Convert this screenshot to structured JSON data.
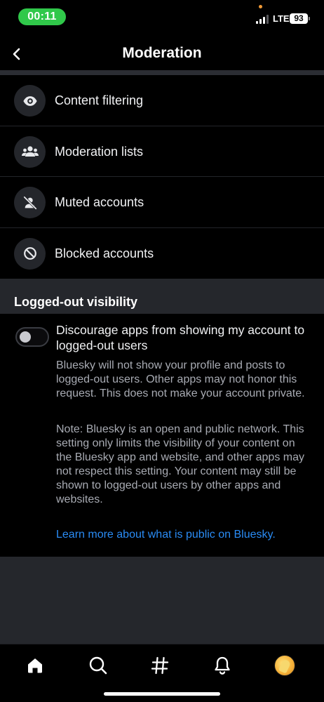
{
  "status_bar": {
    "time": "00:11",
    "network": "LTE",
    "battery": "93"
  },
  "header": {
    "title": "Moderation",
    "back_icon": "chevron-left-icon"
  },
  "menu": {
    "items": [
      {
        "label": "Content filtering",
        "icon": "eye-icon"
      },
      {
        "label": "Moderation lists",
        "icon": "people-icon"
      },
      {
        "label": "Muted accounts",
        "icon": "person-muted-icon"
      },
      {
        "label": "Blocked accounts",
        "icon": "block-icon"
      }
    ]
  },
  "visibility": {
    "section_title": "Logged-out visibility",
    "toggle_label": "Discourage apps from showing my account to logged-out users",
    "toggle_on": false,
    "description": "Bluesky will not show your profile and posts to logged-out users. Other apps may not honor this request. This does not make your account private.",
    "note": "Note: Bluesky is an open and public network. This setting only limits the visibility of your content on the Bluesky app and website, and other apps may not respect this setting. Your content may still be shown to logged-out users by other apps and websites.",
    "learn_more": "Learn more about what is public on Bluesky."
  },
  "bottom_nav": {
    "items": [
      "home-icon",
      "search-icon",
      "hashtag-icon",
      "bell-icon",
      "avatar"
    ]
  },
  "colors": {
    "background": "#000000",
    "section_bg": "#25272c",
    "link": "#2a8cf5",
    "time_pill": "#30c84a"
  }
}
